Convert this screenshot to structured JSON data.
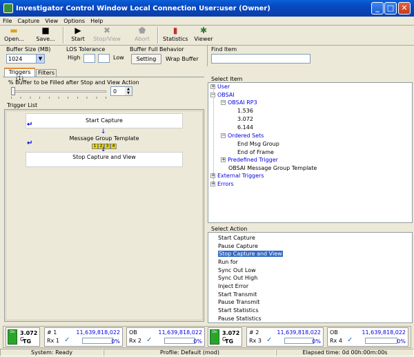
{
  "window": {
    "title": "Investigator Control Window  Local Connection  User:user (Owner)"
  },
  "menu": [
    "File",
    "Capture",
    "View",
    "Options",
    "Help"
  ],
  "toolbar": {
    "open": "Open...",
    "save": "Save...",
    "start": "Start",
    "stop_view": "Stop/View",
    "abort": "Abort",
    "statistics": "Statistics",
    "viewer": "Viewer"
  },
  "controls": {
    "buffer_size_label": "Buffer Size (MB)",
    "buffer_size_value": "1024",
    "los_label": "LOS Tolerance",
    "los_high": "High",
    "los_low": "Low",
    "buffer_full_label": "Buffer Full Behavior",
    "setting_button": "Setting",
    "wrap_buffer": "Wrap Buffer",
    "find_item_label": "Find Item"
  },
  "tabs": [
    "Triggers (1)",
    "Filters"
  ],
  "buffer_fill_label": "% Buffer to be Filled after Stop and View Action",
  "buffer_fill_value": "0",
  "trigger_list": {
    "header": "Trigger List",
    "start": "Start Capture",
    "template": "Message Group Template",
    "template_steps": [
      "1",
      "2",
      "3",
      "4"
    ],
    "stop": "Stop Capture and View"
  },
  "select_item": {
    "header": "Select Item",
    "tree": {
      "user": "User",
      "obsai": "OBSAI",
      "obsai_rp3": "OBSAI RP3",
      "rate1": "1.536",
      "rate2": "3.072",
      "rate3": "6.144",
      "ordered_sets": "Ordered Sets",
      "end_msg_group": "End Msg Group",
      "end_of_frame": "End of Frame",
      "predefined_trigger": "Predefined Trigger",
      "obsai_template": "OBSAI Message Group Template",
      "external_triggers": "External Triggers",
      "errors": "Errors"
    }
  },
  "select_action": {
    "header": "Select Action",
    "items": [
      "Start Capture",
      "Pause Capture",
      "Stop Capture and View",
      "Run for",
      "Sync Out Low",
      "Sync Out High",
      "Inject Error",
      "Start Transmit",
      "Pause Transmit",
      "Start Statistics",
      "Pause Statistics"
    ],
    "selected": "Stop Capture and View"
  },
  "ports": [
    {
      "rate": "3.072",
      "unit": "G",
      "mode": "TG",
      "on": "On"
    },
    {
      "rate": "3.072",
      "unit": "G",
      "mode": "TG",
      "on": "On"
    }
  ],
  "rx": [
    {
      "num": "# 1",
      "name": "Rx 1",
      "count": "11,639,818,022",
      "pct": "0%",
      "fill": 0
    },
    {
      "num": "OB",
      "name": "Rx 2",
      "count": "11,639,818,022",
      "pct": "0%",
      "fill": 0
    },
    {
      "num": "# 2",
      "name": "Rx 3",
      "count": "11,639,818,022",
      "pct": "0%",
      "fill": 0
    },
    {
      "num": "OB",
      "name": "Rx 4",
      "count": "11,639,818,022",
      "pct": "0%",
      "fill": 0
    }
  ],
  "status": {
    "system": "System: Ready",
    "profile": "Profile: Default (mod)",
    "elapsed": "Elapsed time: 0d 00h:00m:00s"
  },
  "colors": {
    "title_bar": "#0848c0",
    "selection": "#316ac5",
    "tree_link": "#0000e0"
  }
}
